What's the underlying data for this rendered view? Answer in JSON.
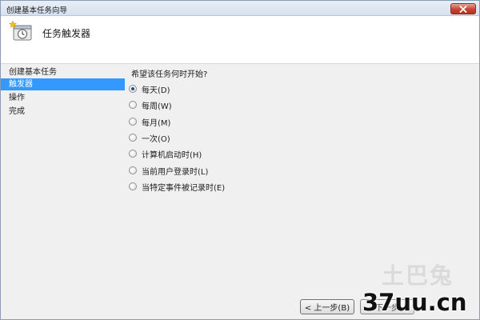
{
  "window": {
    "title": "创建基本任务向导",
    "close_icon": "close-icon"
  },
  "header": {
    "title": "任务触发器",
    "icon": "task-scheduler-clock-icon"
  },
  "nav": {
    "items": [
      {
        "label": "创建基本任务",
        "selected": false
      },
      {
        "label": "触发器",
        "selected": true
      },
      {
        "label": "操作",
        "selected": false
      },
      {
        "label": "完成",
        "selected": false
      }
    ],
    "selected_color": "#3399ff"
  },
  "content": {
    "question": "希望该任务何时开始?",
    "options": [
      {
        "label": "每天(D)",
        "checked": true
      },
      {
        "label": "每周(W)",
        "checked": false
      },
      {
        "label": "每月(M)",
        "checked": false
      },
      {
        "label": "一次(O)",
        "checked": false
      },
      {
        "label": "计算机启动时(H)",
        "checked": false
      },
      {
        "label": "当前用户登录时(L)",
        "checked": false
      },
      {
        "label": "当特定事件被记录时(E)",
        "checked": false
      }
    ]
  },
  "footer": {
    "back_label": "< 上一步(B)",
    "next_label": "下一步"
  },
  "watermark": {
    "logo_text": "土巴兔",
    "site_text": "37uu.cn"
  }
}
